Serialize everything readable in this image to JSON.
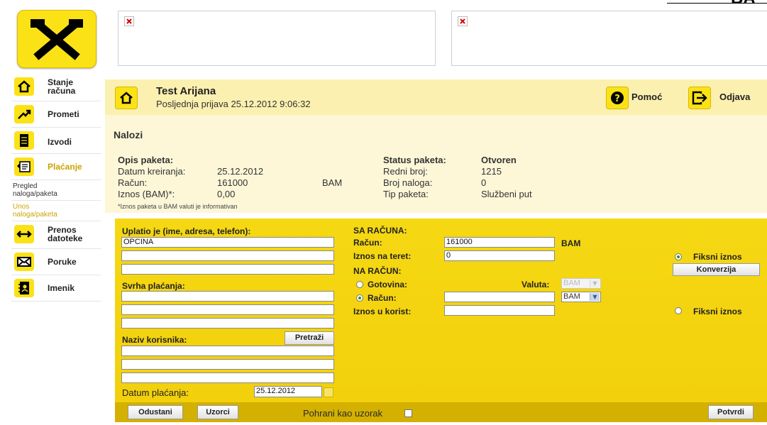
{
  "top": {
    "brand_fragment": "BA"
  },
  "nav": {
    "items": [
      {
        "label_1": "Stanje",
        "label_2": "računa",
        "icon": "home-icon"
      },
      {
        "label_1": "Prometi",
        "icon": "trend-arrow-icon"
      },
      {
        "label_1": "Izvodi",
        "icon": "document-icon"
      },
      {
        "label_1": "Plaćanje",
        "icon": "payment-icon"
      },
      {
        "label_1": "Prenos",
        "label_2": "datoteke",
        "icon": "transfer-icon"
      },
      {
        "label_1": "Poruke",
        "icon": "envelope-icon"
      },
      {
        "label_1": "Imenik",
        "icon": "address-book-icon"
      }
    ],
    "sub_items": [
      {
        "label_1": "Pregled",
        "label_2": "naloga/paketa"
      },
      {
        "label_1": "Unos",
        "label_2": "naloga/paketa"
      }
    ]
  },
  "header": {
    "user_name": "Test Arijana",
    "last_login": "Posljednja prijava 25.12.2012 9:06:32",
    "help_label": "Pomoć",
    "logout_label": "Odjava"
  },
  "info": {
    "page_title": "Nalozi",
    "left_title": "Opis paketa:",
    "date_label": "Datum kreiranja:",
    "date_value": "25.12.2012",
    "account_label": "Račun:",
    "account_value": "161000",
    "currency": "BAM",
    "amount_label": "Iznos (BAM)*:",
    "amount_value": "0,00",
    "note": "*Iznos paketa u BAM valuti je informativan",
    "status_label": "Status paketa:",
    "status_value": "Otvoren",
    "order_no_label": "Redni broj:",
    "order_no_value": "1215",
    "count_label": "Broj naloga:",
    "count_value": "0",
    "type_label": "Tip paketa:",
    "type_value": "Službeni put"
  },
  "form": {
    "payer_label": "Uplatio je (ime, adresa, telefon):",
    "payer_line1": "OPCINA",
    "purpose_label": "Svrha plaćanja:",
    "beneficiary_label": "Naziv korisnika:",
    "search_button": "Pretraži",
    "date_label": "Datum plaćanja:",
    "date_value": "25.12.2012",
    "from_account_title": "SA RAČUNA:",
    "from_account_label": "Račun:",
    "from_account_value": "161000",
    "from_currency": "BAM",
    "debit_amount_label": "Iznos na teret:",
    "debit_amount_value": "0",
    "fixed_amount_label": "Fiksni iznos",
    "conversion_button": "Konverzija",
    "to_account_title": "NA RAČUN:",
    "cash_label": "Gotovina:",
    "currency_label": "Valuta:",
    "cash_currency": "BAM",
    "to_account_label": "Račun:",
    "to_currency": "BAM",
    "credit_amount_label": "Iznos u korist:",
    "fixed_amount_label_2": "Fiksni iznos"
  },
  "footer": {
    "cancel_button": "Odustani",
    "templates_button": "Uzorci",
    "save_template_label": "Pohrani kao uzorak",
    "confirm_button": "Potvrdi"
  }
}
